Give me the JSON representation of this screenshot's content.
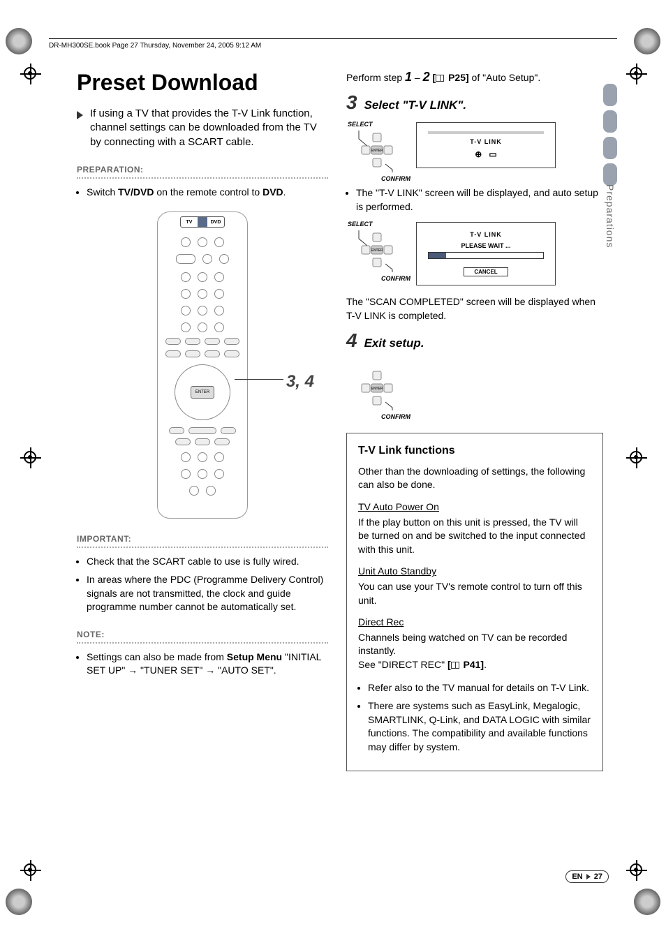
{
  "header": {
    "text": "DR-MH300SE.book  Page 27  Thursday, November 24, 2005  9:12 AM"
  },
  "side": {
    "label": "Preparations"
  },
  "left": {
    "title": "Preset Download",
    "intro": "If using a TV that provides the T-V Link function, channel settings can be downloaded from the TV by connecting with a SCART cable.",
    "prep_label": "PREPARATION:",
    "prep_item_pre": "Switch ",
    "prep_item_b1": "TV/DVD",
    "prep_item_mid": " on the remote control to ",
    "prep_item_b2": "DVD",
    "remote_switch": {
      "tv": "TV",
      "dvd": "DVD"
    },
    "remote_callout": ",",
    "remote_callout_3": "3",
    "remote_callout_4": "4",
    "important_label": "IMPORTANT:",
    "important_items": [
      "Check that the SCART cable to use is fully wired.",
      "In areas where the PDC (Programme Delivery Control) signals are not transmitted, the clock and guide programme number cannot be automatically set."
    ],
    "note_label": "NOTE:",
    "note_pre": "Settings can also be made from ",
    "note_b": "Setup Menu",
    "note_post": " \"INITIAL SET UP\" → \"TUNER SET\" → \"AUTO SET\"."
  },
  "right": {
    "perform_pre": "Perform step ",
    "perform_1": "1",
    "perform_dash": " – ",
    "perform_2": "2",
    "perform_ref": " P25]",
    "perform_post": " of \"Auto Setup\".",
    "step3_num": "3",
    "step3_title": "Select \"T-V LINK\".",
    "dpad_select": "SELECT",
    "dpad_confirm": "CONFIRM",
    "dpad_enter": "ENTER",
    "screen1": {
      "title": "T-V LINK"
    },
    "step3_note": "The \"T-V LINK\" screen will be displayed, and auto setup is performed.",
    "screen2": {
      "title": "T-V LINK",
      "sub": "PLEASE WAIT ...",
      "cancel": "CANCEL"
    },
    "scan_complete": "The \"SCAN COMPLETED\" screen will be displayed when T-V LINK is completed.",
    "step4_num": "4",
    "step4_title": "Exit setup.",
    "tvlink": {
      "heading": "T-V Link functions",
      "intro": "Other than the downloading of settings, the following can also be done.",
      "s1": "TV Auto Power On",
      "s1t": "If the play button on this unit is pressed, the TV will be turned on and be switched to the input connected with this unit.",
      "s2": "Unit Auto Standby",
      "s2t": "You can use your TV's remote control to turn off this unit.",
      "s3": "Direct Rec",
      "s3t": "Channels being watched on TV can be recorded instantly.",
      "s3see_pre": "See \"DIRECT REC\" ",
      "s3see_ref": " P41]",
      "bullets": [
        "Refer also to the TV manual for details on T-V Link.",
        "There are systems such as EasyLink, Megalogic, SMARTLINK, Q-Link, and DATA LOGIC with similar functions. The compatibility and available functions may differ by system."
      ]
    }
  },
  "footer": {
    "lang": "EN",
    "page": "27"
  }
}
